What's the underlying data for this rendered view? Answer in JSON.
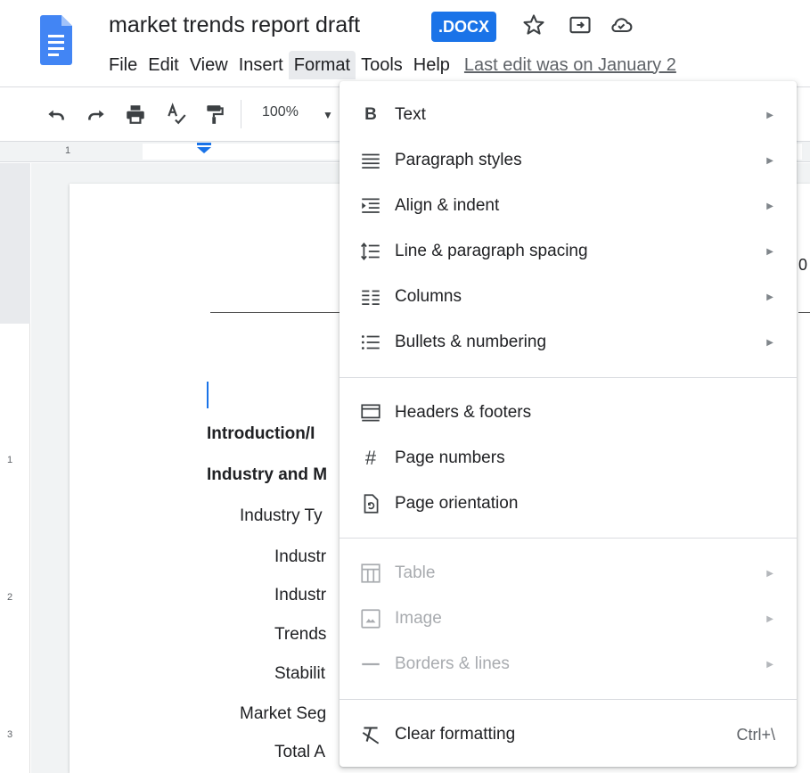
{
  "app": {
    "doc_title": "market trends report draft",
    "file_badge": ".DOCX",
    "icons": [
      "star-icon",
      "move-to-folder-icon",
      "cloud-saved-icon"
    ]
  },
  "menubar": {
    "items": [
      {
        "label": "File"
      },
      {
        "label": "Edit"
      },
      {
        "label": "View"
      },
      {
        "label": "Insert"
      },
      {
        "label": "Format",
        "active": true
      },
      {
        "label": "Tools"
      },
      {
        "label": "Help"
      }
    ],
    "last_edit": "Last edit was on January 2"
  },
  "toolbar": {
    "icons": [
      "undo-icon",
      "redo-icon",
      "print-icon",
      "spellcheck-icon",
      "paint-format-icon"
    ],
    "zoom": "100%"
  },
  "ruler": {
    "top_label": "1",
    "left_labels": [
      "1",
      "2",
      "3"
    ]
  },
  "document": {
    "lines": [
      {
        "text": "Introduction/I",
        "bold": true
      },
      {
        "text": "Industry and M",
        "bold": true
      },
      {
        "text": "Industry Ty",
        "bold": false
      },
      {
        "text": "Industr",
        "bold": false
      },
      {
        "text": "Industr",
        "bold": false
      },
      {
        "text": "Trends",
        "bold": false
      },
      {
        "text": "Stabilit",
        "bold": false
      },
      {
        "text": "Market Seg",
        "bold": false
      },
      {
        "text": "Total A",
        "bold": false
      }
    ],
    "edge_digit": "0"
  },
  "format_menu": {
    "items": [
      {
        "label": "Text",
        "icon": "bold-icon",
        "submenu": true,
        "enabled": true
      },
      {
        "label": "Paragraph styles",
        "icon": "paragraph-styles-icon",
        "submenu": true,
        "enabled": true
      },
      {
        "label": "Align & indent",
        "icon": "align-indent-icon",
        "submenu": true,
        "enabled": true
      },
      {
        "label": "Line & paragraph spacing",
        "icon": "line-spacing-icon",
        "submenu": true,
        "enabled": true
      },
      {
        "label": "Columns",
        "icon": "columns-icon",
        "submenu": true,
        "enabled": true
      },
      {
        "label": "Bullets & numbering",
        "icon": "bullets-icon",
        "submenu": true,
        "enabled": true
      },
      {
        "label": "Headers & footers",
        "icon": "headers-footers-icon",
        "submenu": false,
        "enabled": true
      },
      {
        "label": "Page numbers",
        "icon": "hash-icon",
        "submenu": false,
        "enabled": true
      },
      {
        "label": "Page orientation",
        "icon": "page-orientation-icon",
        "submenu": false,
        "enabled": true
      },
      {
        "label": "Table",
        "icon": "table-icon",
        "submenu": true,
        "enabled": false
      },
      {
        "label": "Image",
        "icon": "image-icon",
        "submenu": true,
        "enabled": false
      },
      {
        "label": "Borders & lines",
        "icon": "borders-lines-icon",
        "submenu": true,
        "enabled": false
      },
      {
        "label": "Clear formatting",
        "icon": "clear-formatting-icon",
        "submenu": false,
        "enabled": true,
        "shortcut": "Ctrl+\\"
      }
    ]
  },
  "colors": {
    "accent": "#1a73e8",
    "doc_icon": "#4285f4",
    "disabled_text": "#a8abaf"
  }
}
